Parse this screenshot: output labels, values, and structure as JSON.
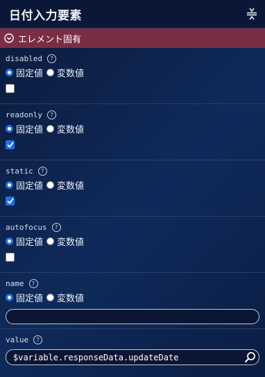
{
  "header": {
    "title": "日付入力要素",
    "collapse_icon": "collapse-vertical-icon"
  },
  "section": {
    "label": "エレメント固有",
    "icon": "chevron-circle-down-icon"
  },
  "radio_labels": {
    "fixed": "固定値",
    "variable": "変数値"
  },
  "properties": [
    {
      "name": "disabled",
      "mode": "fixed",
      "type": "checkbox",
      "checked": false
    },
    {
      "name": "readonly",
      "mode": "fixed",
      "type": "checkbox",
      "checked": true
    },
    {
      "name": "static",
      "mode": "fixed",
      "type": "checkbox",
      "checked": true
    },
    {
      "name": "autofocus",
      "mode": "fixed",
      "type": "checkbox",
      "checked": false
    },
    {
      "name": "name",
      "mode": "fixed",
      "type": "text",
      "value": ""
    },
    {
      "name": "value",
      "type": "variable",
      "value": "$variable.responseData.updateDate"
    }
  ],
  "help_icon": "?",
  "colors": {
    "section_bar": "#7a2e45",
    "accent": "#1f6fe5"
  }
}
